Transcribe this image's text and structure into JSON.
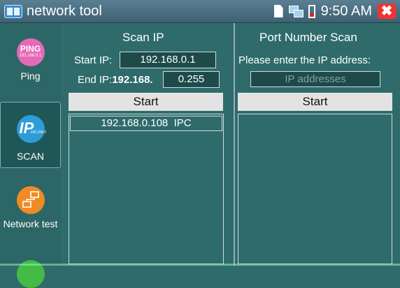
{
  "titlebar": {
    "title": "network tool",
    "time": "9:50 AM",
    "close_symbol": "✖"
  },
  "sidebar": {
    "items": [
      {
        "label": "Ping",
        "icon": "ping-icon",
        "icon_text": "PING",
        "icon_subtext": "192.168.0.1"
      },
      {
        "label": "SCAN",
        "icon": "scan-icon",
        "icon_text": "IP",
        "icon_subtext": "192.168.0"
      },
      {
        "label": "Network test",
        "icon": "network-test-icon"
      },
      {
        "label": "",
        "icon": "green-circle-icon"
      }
    ]
  },
  "scan_ip": {
    "title": "Scan IP",
    "start_label": "Start IP:",
    "start_value": "192.168.0.1",
    "end_label": "End IP:",
    "end_prefix": "192.168.",
    "end_value": "0.255",
    "start_button": "Start",
    "results": [
      {
        "ip": "192.168.0.108",
        "type": "IPC"
      }
    ]
  },
  "port_scan": {
    "title": "Port Number Scan",
    "prompt": "Please enter the IP address:",
    "placeholder": "IP addresses",
    "start_button": "Start"
  }
}
